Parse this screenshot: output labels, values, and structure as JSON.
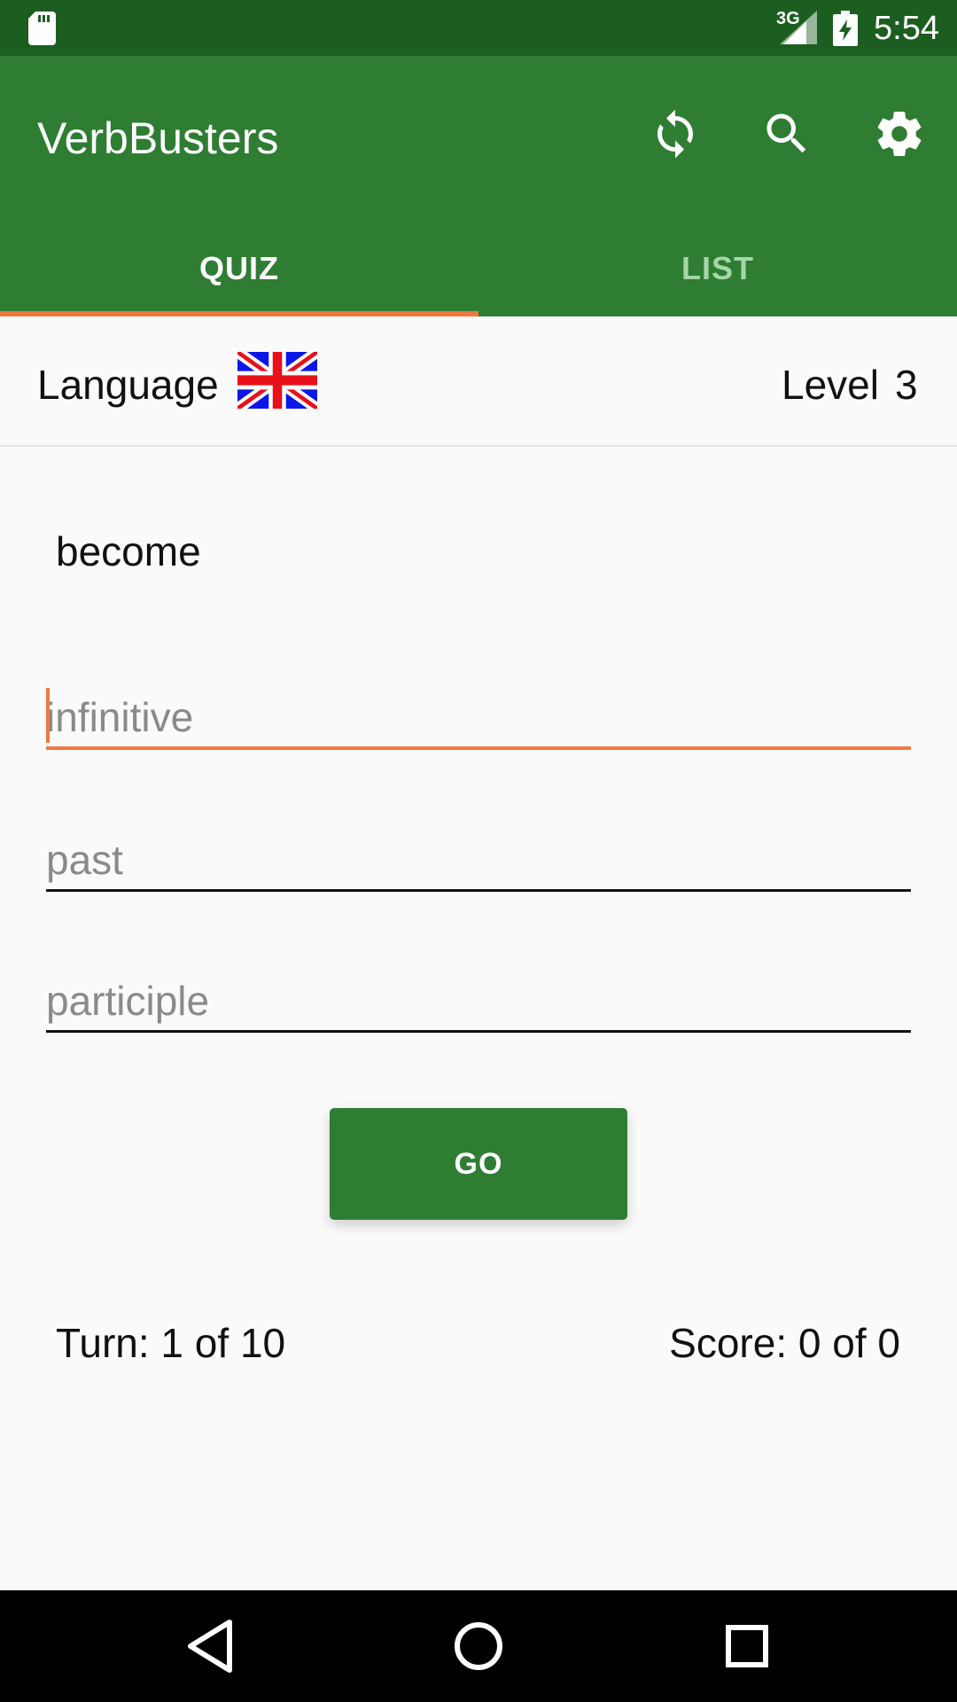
{
  "status_bar": {
    "network": "3G",
    "time": "5:54",
    "icons": [
      "sd-card-icon",
      "signal-icon",
      "battery-icon"
    ]
  },
  "app_bar": {
    "title": "VerbBusters",
    "actions": [
      "refresh-icon",
      "search-icon",
      "settings-icon"
    ]
  },
  "tabs": {
    "quiz": "QUIZ",
    "list": "LIST",
    "selected": "QUIZ"
  },
  "language_row": {
    "language_label": "Language",
    "flag_icon": "uk-flag-icon",
    "level_label": "Level",
    "level_value": "3"
  },
  "quiz": {
    "word": "become",
    "infinitive_placeholder": "infinitive",
    "past_placeholder": "past",
    "participle_placeholder": "participle",
    "go_label": "GO",
    "turn": "Turn: 1 of 10",
    "score": "Score: 0 of 0"
  },
  "nav_bar": {
    "buttons": [
      "back-icon",
      "home-icon",
      "recents-icon"
    ]
  },
  "colors": {
    "status_bar": "#1b5e20",
    "primary": "#2e7d32",
    "accent": "#f07840",
    "inactive_tab": "#a5d6a7",
    "background": "#fafafa"
  }
}
